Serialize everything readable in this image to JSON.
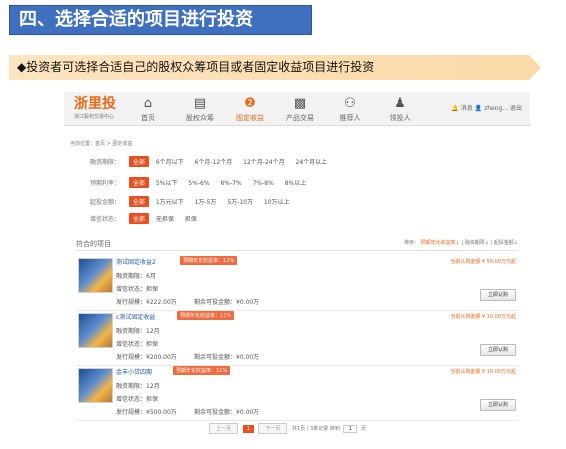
{
  "slide": {
    "title": "四、选择合适的项目进行投资",
    "bullet": "◆投资者可选择合适自己的股权众筹项目或者固定收益项目进行投资"
  },
  "header": {
    "logo": "浙里投",
    "logo_sub": "浙江股权交易中心",
    "nav": [
      {
        "label": "首页",
        "icon": "⌂"
      },
      {
        "label": "股权众筹",
        "icon": "▤"
      },
      {
        "label": "固定收益",
        "icon": "❷"
      },
      {
        "label": "产品交易",
        "icon": "▩"
      },
      {
        "label": "推荐人",
        "icon": "⚇"
      },
      {
        "label": "领投人",
        "icon": "♟"
      }
    ],
    "messages": "消息",
    "user": "zheng...",
    "logout": "退出"
  },
  "breadcrumb": "当前位置：首页 > 固定收益",
  "filters": [
    {
      "label": "融资期限：",
      "all": "全部",
      "options": [
        "6个月以下",
        "6个月-12个月",
        "12个月-24个月",
        "24个月以上"
      ]
    },
    {
      "label": "预期利率：",
      "all": "全部",
      "options": [
        "5%以下",
        "5%-6%",
        "6%-7%",
        "7%-8%",
        "8%以上"
      ]
    },
    {
      "label": "起投金额：",
      "all": "全部",
      "options": [
        "1万元以下",
        "1万-5万",
        "5万-10万",
        "10万以上"
      ]
    },
    {
      "label": "增信状态：",
      "all": "全部",
      "options": [
        "无担保",
        "担保"
      ]
    }
  ],
  "section_title": "符合的项目",
  "sort": {
    "prefix": "排序：",
    "active": "预期年化收益率↓",
    "opt1": "融资期限↓",
    "opt2": "起投金额↓"
  },
  "projects": [
    {
      "name": "测试固定收益2",
      "rate": "预期年化收益率：12%",
      "term": "融资期限：6月",
      "credit": "增信状态：担保",
      "scale": "发行规模：¥222.00万",
      "remaining": "剩余可投金额：¥0.00万",
      "min": "当前认购金额 ¥ 50.00万元起",
      "buy": "立即认购"
    },
    {
      "name": "c测试固定收益",
      "rate": "预期年化收益率：11%",
      "term": "融资期限：12月",
      "credit": "增信状态：担保",
      "scale": "发行规模：¥200.00万",
      "remaining": "剩余可投金额：¥0.00万",
      "min": "当前认购金额 ¥ 10.00万元起",
      "buy": "立即认购"
    },
    {
      "name": "金丰小贷四期",
      "rate": "预期年化收益率：11%",
      "term": "融资期限：12月",
      "credit": "增信状态：担保",
      "scale": "发行规模：¥500.00万",
      "remaining": "剩余可投金额：¥0.00万",
      "min": "当前认购金额 ¥ 10.00万元起",
      "buy": "立即认购"
    }
  ],
  "pager": {
    "prev": "上一页",
    "current": "1",
    "next": "下一页",
    "info": "共1页 / 3条记录",
    "goto": "转到",
    "page_value": "1",
    "page_unit": "页"
  }
}
